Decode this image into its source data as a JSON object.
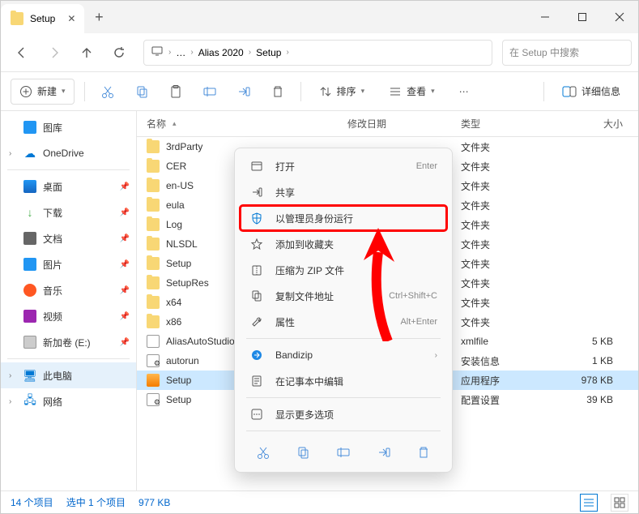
{
  "tab": {
    "title": "Setup"
  },
  "breadcrumb": {
    "ellipsis": "…",
    "items": [
      "Alias 2020",
      "Setup"
    ]
  },
  "search": {
    "placeholder": "在 Setup 中搜索"
  },
  "toolbar": {
    "new_label": "新建",
    "sort_label": "排序",
    "view_label": "查看",
    "details_label": "详细信息"
  },
  "sidebar": {
    "items": [
      {
        "label": "图库",
        "icon": "gallery"
      },
      {
        "label": "OneDrive",
        "icon": "cloud",
        "expandable": true
      },
      {
        "label": "桌面",
        "icon": "desktop",
        "pinned": true
      },
      {
        "label": "下载",
        "icon": "download",
        "pinned": true
      },
      {
        "label": "文档",
        "icon": "doc",
        "pinned": true
      },
      {
        "label": "图片",
        "icon": "pic",
        "pinned": true
      },
      {
        "label": "音乐",
        "icon": "music",
        "pinned": true
      },
      {
        "label": "视频",
        "icon": "video",
        "pinned": true
      },
      {
        "label": "新加卷 (E:)",
        "icon": "drive",
        "pinned": true
      },
      {
        "label": "此电脑",
        "icon": "pc",
        "expandable": true,
        "selected": true
      },
      {
        "label": "网络",
        "icon": "net",
        "expandable": true
      }
    ]
  },
  "headers": {
    "name": "名称",
    "date": "修改日期",
    "type": "类型",
    "size": "大小"
  },
  "files": [
    {
      "name": "3rdParty",
      "icon": "folder",
      "type": "文件夹",
      "size": ""
    },
    {
      "name": "CER",
      "icon": "folder",
      "type": "文件夹",
      "size": ""
    },
    {
      "name": "en-US",
      "icon": "folder",
      "type": "文件夹",
      "size": ""
    },
    {
      "name": "eula",
      "icon": "folder",
      "type": "文件夹",
      "size": ""
    },
    {
      "name": "Log",
      "icon": "folder",
      "type": "文件夹",
      "size": ""
    },
    {
      "name": "NLSDL",
      "icon": "folder",
      "type": "文件夹",
      "size": ""
    },
    {
      "name": "Setup",
      "icon": "folder",
      "type": "文件夹",
      "size": ""
    },
    {
      "name": "SetupRes",
      "icon": "folder",
      "type": "文件夹",
      "size": ""
    },
    {
      "name": "x64",
      "icon": "folder",
      "type": "文件夹",
      "size": ""
    },
    {
      "name": "x86",
      "icon": "folder",
      "type": "文件夹",
      "size": ""
    },
    {
      "name": "AliasAutoStudio",
      "icon": "xml",
      "type": "xmlfile",
      "size": "5 KB"
    },
    {
      "name": "autorun",
      "icon": "ini",
      "type": "安装信息",
      "size": "1 KB"
    },
    {
      "name": "Setup",
      "icon": "exe",
      "type": "应用程序",
      "size": "978 KB",
      "selected": true
    },
    {
      "name": "Setup",
      "icon": "cfg",
      "type": "配置设置",
      "size": "39 KB"
    }
  ],
  "context": {
    "items": [
      {
        "label": "打开",
        "icon": "open",
        "shortcut": "Enter"
      },
      {
        "label": "共享",
        "icon": "share"
      },
      {
        "label": "以管理员身份运行",
        "icon": "shield",
        "highlighted": true
      },
      {
        "label": "添加到收藏夹",
        "icon": "star"
      },
      {
        "label": "压缩为 ZIP 文件",
        "icon": "zip"
      },
      {
        "label": "复制文件地址",
        "icon": "copypath",
        "shortcut": "Ctrl+Shift+C"
      },
      {
        "label": "属性",
        "icon": "props",
        "shortcut": "Alt+Enter"
      },
      {
        "label": "Bandizip",
        "icon": "bandizip",
        "submenu": true
      },
      {
        "label": "在记事本中编辑",
        "icon": "notepad"
      },
      {
        "label": "显示更多选项",
        "icon": "more"
      }
    ]
  },
  "status": {
    "count": "14 个项目",
    "selection": "选中 1 个项目",
    "size": "977 KB"
  }
}
